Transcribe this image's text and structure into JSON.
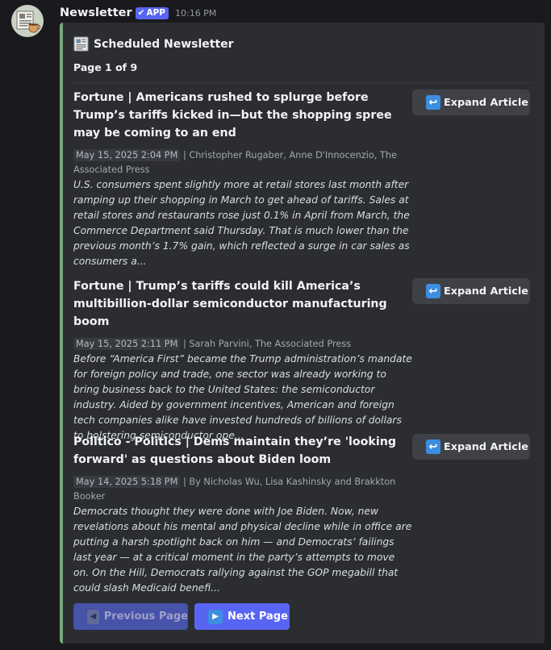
{
  "message": {
    "bot_name": "Newsletter",
    "badge": "APP",
    "badge_check": "✔",
    "timestamp": "10:16 PM",
    "avatar_icon": "newspaper-coffee-icon"
  },
  "embed": {
    "accent_color": "#78a87c",
    "title": "Scheduled Newsletter",
    "title_icon": "newspaper-icon",
    "page_label": "Page 1 of 9",
    "articles": [
      {
        "title": "Fortune | Americans rushed to splurge before Trump’s tariffs kicked in—but the shopping spree may be coming to an end",
        "date": "May 15, 2025 2:04 PM",
        "authors": "| Christopher Rugaber, Anne D'Innocenzio, The Associated Press",
        "summary": "U.S. consumers spent slightly more at retail stores last month after ramping up their shopping in March to get ahead of tariffs. Sales at retail stores and restaurants rose just 0.1% in April from March, the Commerce Department said Thursday. That is much lower than the previous month’s 1.7% gain, which reflected a surge in car sales as consumers a...",
        "button_label": "Expand Article"
      },
      {
        "title": "Fortune | Trump’s tariffs could kill America’s multibillion-dollar semiconductor manufacturing boom",
        "date": "May 15, 2025 2:11 PM",
        "authors": "| Sarah Parvini, The Associated Press",
        "summary": "Before “America First” became the Trump administration’s mandate for foreign policy and trade, one sector was already working to bring business back to the United States: the semiconductor industry. Aided by government incentives, American and foreign tech companies alike have invested hundreds of billions of dollars to bolstering semiconductor ope...",
        "button_label": "Expand Article"
      },
      {
        "title": "Politico - Politics | Dems maintain they’re 'looking forward' as questions about Biden loom",
        "date": "May 14, 2025 5:18 PM",
        "authors": "| By Nicholas Wu, Lisa Kashinsky and Brakkton Booker",
        "summary": "Democrats thought they were done with Joe Biden. Now, new revelations about his mental and physical decline while in office are putting a harsh spotlight back on him — and Democrats’ failings last year — at a critical moment in the party’s attempts to move on. On the Hill, Democrats rallying against the GOP megabill that could slash Medicaid benefi...",
        "button_label": "Expand Article"
      }
    ],
    "expand_icon": "↩",
    "prev_button": {
      "label": "Previous Page",
      "icon": "◀",
      "disabled": true
    },
    "next_button": {
      "label": "Next Page",
      "icon": "▶"
    }
  }
}
